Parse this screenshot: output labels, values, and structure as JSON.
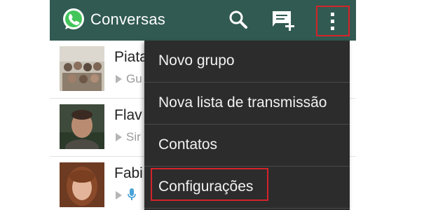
{
  "app_bar": {
    "title": "Conversas",
    "logo_icon": "whatsapp-logo-icon",
    "background_color": "#315a52",
    "actions": [
      {
        "name": "search-button",
        "icon": "search-icon"
      },
      {
        "name": "new-chat-button",
        "icon": "new-chat-icon"
      },
      {
        "name": "overflow-menu-button",
        "icon": "more-vertical-icon",
        "highlighted": true
      }
    ]
  },
  "chats": [
    {
      "name": "Piata",
      "preview": "Gu",
      "avatar": "group-photo",
      "status_icon": "arrow-icon"
    },
    {
      "name": "Flav",
      "preview": "Sir",
      "avatar": "person-photo",
      "status_icon": "arrow-icon"
    },
    {
      "name": "Fabi",
      "preview": "",
      "avatar": "person-photo",
      "status_icon": "microphone-icon"
    }
  ],
  "overflow_menu": {
    "items": [
      {
        "label": "Novo grupo"
      },
      {
        "label": "Nova lista de transmissão"
      },
      {
        "label": "Contatos"
      },
      {
        "label": "Configurações",
        "highlighted": true
      }
    ],
    "background_color": "#2c2c2c",
    "highlight_color": "#d3232a"
  }
}
